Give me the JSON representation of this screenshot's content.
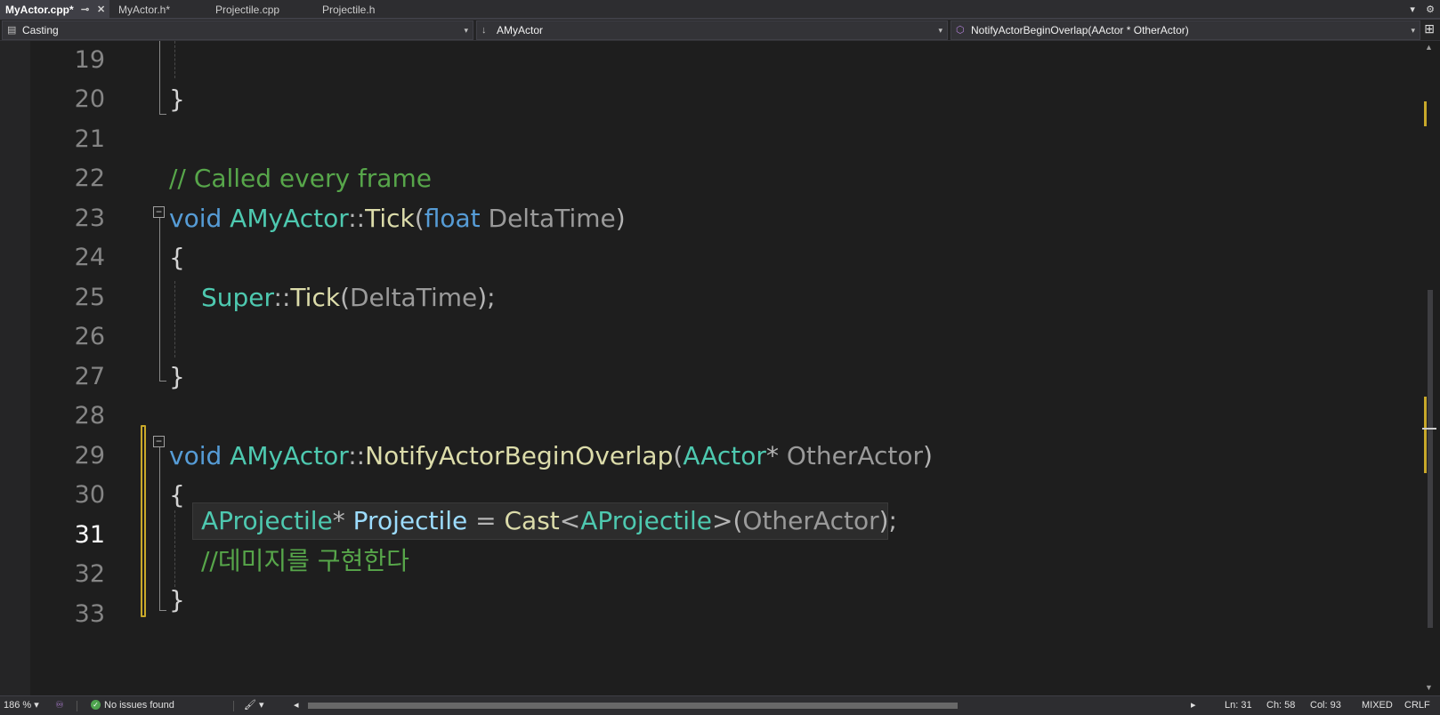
{
  "tabs": [
    {
      "label": "MyActor.cpp*",
      "active": true
    },
    {
      "label": "MyActor.h*",
      "active": false
    },
    {
      "label": "Projectile.cpp",
      "active": false
    },
    {
      "label": "Projectile.h",
      "active": false
    }
  ],
  "tab_icons": {
    "pin": "⊸",
    "close": "✕",
    "overflow": "▾",
    "settings": "⚙"
  },
  "navbar": {
    "project": "Casting",
    "scope": "AMyActor",
    "member": "NotifyActorBeginOverlap(AActor * OtherActor)",
    "scope_icon": "↓",
    "member_icon": "⬡",
    "project_icon": "▤",
    "dropdown_arrow": "▾",
    "split_icon": "⊞"
  },
  "editor": {
    "current_line": 31,
    "line_numbers": [
      "19",
      "20",
      "21",
      "22",
      "23",
      "24",
      "25",
      "26",
      "27",
      "28",
      "29",
      "30",
      "31",
      "32",
      "33"
    ],
    "fold_collapse": "−",
    "code": {
      "l20": "}",
      "l22": "// Called every frame",
      "l23": {
        "kw": "void",
        "cls": "AMyActor",
        "sep": "::",
        "fn": "Tick",
        "p1": "(",
        "t": "float",
        "arg": " DeltaTime",
        "p2": ")"
      },
      "l24": "{",
      "l25": {
        "cls": "Super",
        "sep": "::",
        "fn": "Tick",
        "p1": "(",
        "arg": "DeltaTime",
        "p2": ");"
      },
      "l27": "}",
      "l29": {
        "kw": "void",
        "cls": "AMyActor",
        "sep": "::",
        "fn": "NotifyActorBeginOverlap",
        "p1": "(",
        "t": "AActor",
        "star": "*",
        "arg": " OtherActor",
        "p2": ")"
      },
      "l30": "{",
      "l31": {
        "t1": "AProjectile",
        "star": "*",
        "var": " Projectile",
        "eq": " = ",
        "fn": "Cast",
        "lt": "<",
        "t2": "AProjectile",
        "gt": ">",
        "p1": "(",
        "arg": "OtherActor",
        "p2": ");"
      },
      "l32": "//데미지를 구현한다",
      "l33": "}"
    }
  },
  "statusbar": {
    "zoom": "186 %",
    "zoom_arrow": "▾",
    "issues": "No issues found",
    "issues_icon": "✓",
    "brush_icon": "🖌",
    "scroll_left": "◂",
    "scroll_right": "▸",
    "ln": "Ln: 31",
    "ch": "Ch: 58",
    "col": "Col: 93",
    "mode": "MIXED",
    "eol": "CRLF"
  },
  "colors": {
    "keyword": "#569cd6",
    "type": "#4ec9b0",
    "function": "#dcdcaa",
    "comment": "#57a64a",
    "change_marker": "#c8a82a"
  }
}
